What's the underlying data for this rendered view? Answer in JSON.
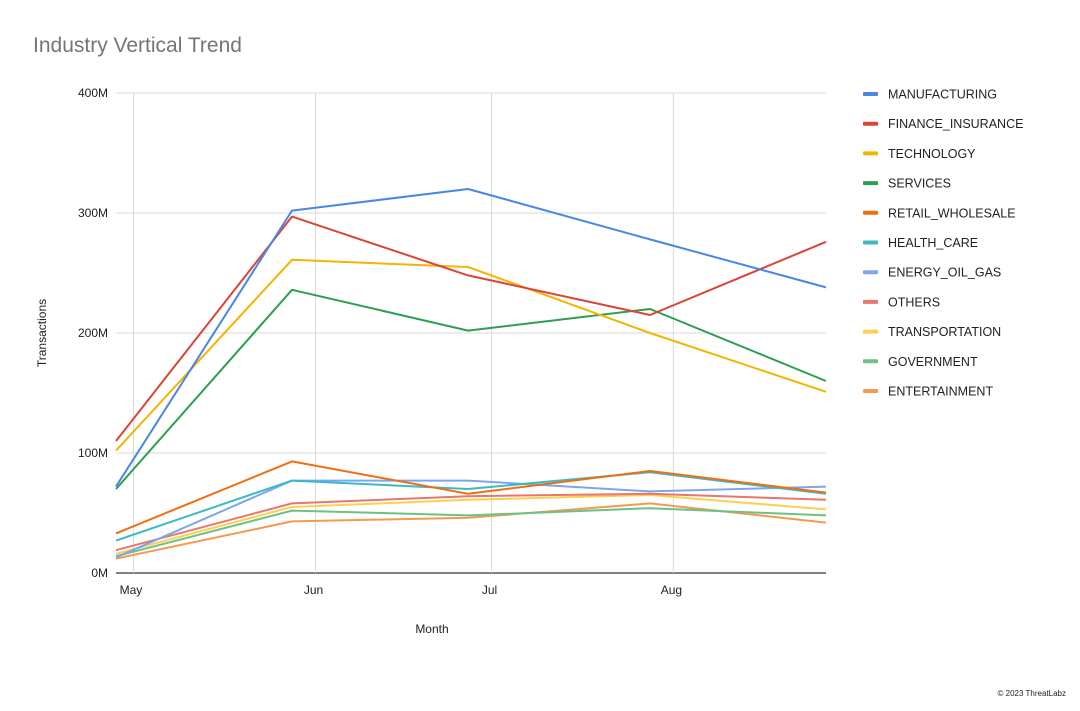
{
  "chart_data": {
    "type": "line",
    "title": "Industry Vertical Trend",
    "xlabel": "Month",
    "ylabel": "Transactions",
    "x_ticks": [
      {
        "label": "May",
        "day": 0
      },
      {
        "label": "Jun",
        "day": 31
      },
      {
        "label": "Jul",
        "day": 61
      },
      {
        "label": "Aug",
        "day": 92
      }
    ],
    "x_days": [
      -3,
      27,
      57,
      88,
      118
    ],
    "x_range_days": [
      -3,
      118
    ],
    "y_ticks": [
      {
        "label": "0M",
        "value": 0
      },
      {
        "label": "100M",
        "value": 100
      },
      {
        "label": "200M",
        "value": 200
      },
      {
        "label": "300M",
        "value": 300
      },
      {
        "label": "400M",
        "value": 400
      }
    ],
    "ylim": [
      0,
      400
    ],
    "y_unit": "M",
    "grid": true,
    "legend_position": "right",
    "series": [
      {
        "name": "MANUFACTURING",
        "color": "#4a86e8",
        "values": [
          72,
          302,
          320,
          278,
          238
        ]
      },
      {
        "name": "FINANCE_INSURANCE",
        "color": "#db4437",
        "values": [
          110,
          297,
          248,
          215,
          276
        ]
      },
      {
        "name": "TECHNOLOGY",
        "color": "#f4b400",
        "values": [
          102,
          261,
          255,
          200,
          151
        ]
      },
      {
        "name": "SERVICES",
        "color": "#2e9e4f",
        "values": [
          70,
          236,
          202,
          220,
          160
        ]
      },
      {
        "name": "RETAIL_WHOLESALE",
        "color": "#f06e10",
        "values": [
          33,
          93,
          66,
          85,
          67
        ]
      },
      {
        "name": "HEALTH_CARE",
        "color": "#3bbac4",
        "values": [
          27,
          77,
          70,
          84,
          66
        ]
      },
      {
        "name": "ENERGY_OIL_GAS",
        "color": "#7ba6ef",
        "values": [
          13,
          77,
          77,
          68,
          72
        ]
      },
      {
        "name": "OTHERS",
        "color": "#e8766e",
        "values": [
          19,
          58,
          64,
          66,
          61
        ]
      },
      {
        "name": "TRANSPORTATION",
        "color": "#fcd04f",
        "values": [
          16,
          55,
          61,
          65,
          53
        ]
      },
      {
        "name": "GOVERNMENT",
        "color": "#6cc187",
        "values": [
          14,
          52,
          48,
          54,
          48
        ]
      },
      {
        "name": "ENTERTAINMENT",
        "color": "#f6994f",
        "values": [
          12,
          43,
          46,
          58,
          42
        ]
      }
    ]
  },
  "footer": {
    "copyright": "© 2023 ThreatLabz"
  }
}
